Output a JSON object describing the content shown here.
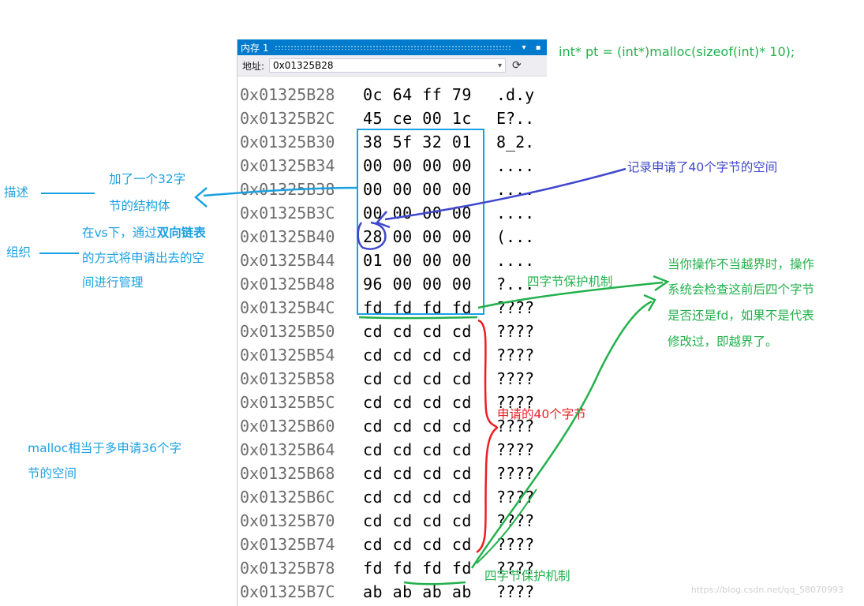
{
  "memory_window": {
    "title": "内存 1",
    "pin_glyph": "▾",
    "max_glyph": "▪",
    "address_label": "地址:",
    "address_value": "0x01325B28",
    "dropdown_glyph": "▾",
    "refresh_glyph": "⟳",
    "rows": [
      {
        "addr": "0x01325B28",
        "bytes": "0c 64 ff 79",
        "ascii": ".d.y"
      },
      {
        "addr": "0x01325B2C",
        "bytes": "45 ce 00 1c",
        "ascii": "E?.."
      },
      {
        "addr": "0x01325B30",
        "bytes": "38 5f 32 01",
        "ascii": "8_2."
      },
      {
        "addr": "0x01325B34",
        "bytes": "00 00 00 00",
        "ascii": "...."
      },
      {
        "addr": "0x01325B38",
        "bytes": "00 00 00 00",
        "ascii": "...."
      },
      {
        "addr": "0x01325B3C",
        "bytes": "00 00 00 00",
        "ascii": "...."
      },
      {
        "addr": "0x01325B40",
        "bytes": "28 00 00 00",
        "ascii": "(..."
      },
      {
        "addr": "0x01325B44",
        "bytes": "01 00 00 00",
        "ascii": "...."
      },
      {
        "addr": "0x01325B48",
        "bytes": "96 00 00 00",
        "ascii": "?..."
      },
      {
        "addr": "0x01325B4C",
        "bytes": "fd fd fd fd",
        "ascii": "????"
      },
      {
        "addr": "0x01325B50",
        "bytes": "cd cd cd cd",
        "ascii": "????"
      },
      {
        "addr": "0x01325B54",
        "bytes": "cd cd cd cd",
        "ascii": "????"
      },
      {
        "addr": "0x01325B58",
        "bytes": "cd cd cd cd",
        "ascii": "????"
      },
      {
        "addr": "0x01325B5C",
        "bytes": "cd cd cd cd",
        "ascii": "????"
      },
      {
        "addr": "0x01325B60",
        "bytes": "cd cd cd cd",
        "ascii": "????"
      },
      {
        "addr": "0x01325B64",
        "bytes": "cd cd cd cd",
        "ascii": "????"
      },
      {
        "addr": "0x01325B68",
        "bytes": "cd cd cd cd",
        "ascii": "????"
      },
      {
        "addr": "0x01325B6C",
        "bytes": "cd cd cd cd",
        "ascii": "????"
      },
      {
        "addr": "0x01325B70",
        "bytes": "cd cd cd cd",
        "ascii": "????"
      },
      {
        "addr": "0x01325B74",
        "bytes": "cd cd cd cd",
        "ascii": "????"
      },
      {
        "addr": "0x01325B78",
        "bytes": "fd fd fd fd",
        "ascii": "????"
      },
      {
        "addr": "0x01325B7C",
        "bytes": "ab ab ab ab",
        "ascii": "????"
      }
    ]
  },
  "annotations": {
    "code": "int* pt = (int*)malloc(sizeof(int)* 10);",
    "describe_label": "描述",
    "describe_text_1": "加了一个32字",
    "describe_text_2": "节的结构体",
    "organize_label": "组织",
    "organize_text_1_prefix": "在vs下，通过",
    "organize_text_1_bold": "双向链表",
    "organize_text_2": "的方式将申请出去的空",
    "organize_text_3": "间进行管理",
    "record_text": "记录申请了40个字节的空间",
    "guard_top": "四字节保护机制",
    "guard_bottom": "四字节保护机制",
    "requested_40": "申请的40个字节",
    "malloc_text_1": "malloc相当于多申请36个字",
    "malloc_text_2": "节的空间",
    "overflow_1": "当你操作不当越界时，操作",
    "overflow_2": "系统会检查这前后四个字节",
    "overflow_3": "是否还是fd，如果不是代表",
    "overflow_4": "修改过，即越界了。",
    "watermark": "https://blog.csdn.net/qq_58070993"
  },
  "colors": {
    "title_bar": "#007acc",
    "blue_annotation": "#1ba1e2",
    "green_annotation": "#22b14c",
    "red_annotation": "#ed1c24",
    "indigo_annotation": "#3f48cc"
  }
}
